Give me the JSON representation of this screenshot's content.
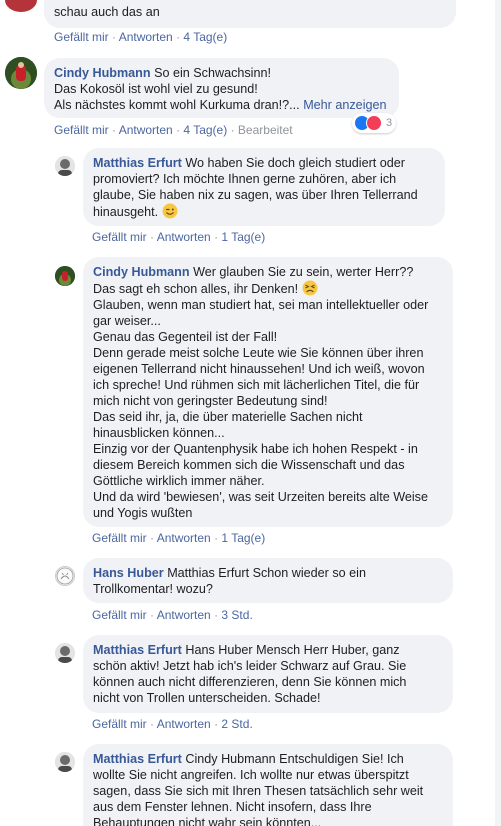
{
  "comments": [
    {
      "id": "c0",
      "author": "",
      "lines": [
        "schau auch das an"
      ],
      "actions": {
        "like": "Gefällt mir",
        "reply": "Antworten",
        "time": "4 Tag(e)"
      }
    },
    {
      "id": "c1",
      "author": "Cindy Hubmann",
      "lines": [
        "So ein Schwachsinn!",
        "Das Kokosöl ist wohl viel zu gesund!",
        "Als nächstes kommt wohl Kurkuma dran!?..."
      ],
      "more": "Mehr anzeigen",
      "actions": {
        "like": "Gefällt mir",
        "reply": "Antworten",
        "time": "4 Tag(e)",
        "edited": "Bearbeitet"
      },
      "reaction_count": "3"
    },
    {
      "id": "c2",
      "author": "Matthias Erfurt",
      "lines": [
        "Wo haben Sie doch gleich studiert oder",
        "promoviert? Ich möchte Ihnen gerne zuhören, aber ich",
        "glaube, Sie haben nix zu sagen, was über Ihren Tellerrand",
        "hinausgeht."
      ],
      "actions": {
        "like": "Gefällt mir",
        "reply": "Antworten",
        "time": "1 Tag(e)"
      }
    },
    {
      "id": "c3",
      "author": "Cindy Hubmann",
      "lines": [
        "Wer glauben Sie zu sein, werter Herr??",
        "Das sagt eh schon alles, ihr Denken!",
        "Glauben, wenn man studiert hat, sei man intellektueller oder",
        "gar weiser...",
        "Genau das Gegenteil ist der Fall!",
        "Denn gerade meist solche Leute wie Sie können über ihren",
        "eigenen Tellerrand nicht hinaussehen! Und ich weiß, wovon",
        "ich spreche! Und rühmen sich mit lächerlichen Titel, die für",
        "mich nicht von geringster Bedeutung sind!",
        "Das seid ihr, ja, die über materielle Sachen nicht",
        "hinausblicken können...",
        "Einzig vor der Quantenphysik habe ich hohen Respekt - in",
        "diesem Bereich kommen sich die Wissenschaft und das",
        "Göttliche wirklich immer näher.",
        "Und da wird 'bewiesen', was seit Urzeiten bereits alte Weise",
        "und Yogis wußten"
      ],
      "actions": {
        "like": "Gefällt mir",
        "reply": "Antworten",
        "time": "1 Tag(e)"
      }
    },
    {
      "id": "c4",
      "author": "Hans Huber",
      "lines": [
        "Matthias Erfurt Schon wieder so ein",
        "Trollkomentar! wozu?"
      ],
      "actions": {
        "like": "Gefällt mir",
        "reply": "Antworten",
        "time": "3 Std."
      }
    },
    {
      "id": "c5",
      "author": "Matthias Erfurt",
      "lines": [
        "Hans Huber Mensch Herr Huber, ganz",
        "schön aktiv! Jetzt hab ich's leider Schwarz auf Grau. Sie",
        "können auch nicht differenzieren, denn Sie können mich",
        "nicht von Trollen unterscheiden. Schade!"
      ],
      "actions": {
        "like": "Gefällt mir",
        "reply": "Antworten",
        "time": "2 Std."
      }
    },
    {
      "id": "c6",
      "author": "Matthias Erfurt",
      "lines": [
        "Cindy Hubmann Entschuldigen Sie! Ich",
        "wollte Sie nicht angreifen. Ich wollte nur etwas überspitzt",
        "sagen, dass Sie sich mit Ihren Thesen tatsächlich sehr weit",
        "aus dem Fenster lehnen. Nicht insofern, dass Ihre",
        "Behauptungen nicht wahr sein könnten..."
      ]
    }
  ],
  "separator": "·",
  "colors": {
    "bubble": "#f0f2f5",
    "author": "#385898",
    "link": "#4b67a1",
    "meta": "#90949c"
  }
}
